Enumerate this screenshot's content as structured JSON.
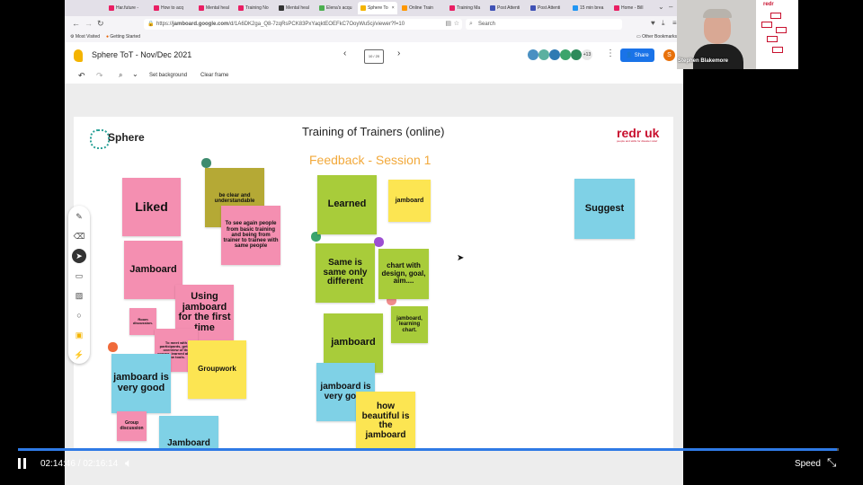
{
  "browser": {
    "tabs": [
      {
        "label": "Har.future -",
        "color": "#e91e63"
      },
      {
        "label": "How to acq",
        "color": "#e91e63"
      },
      {
        "label": "Mental heal",
        "color": "#e91e63"
      },
      {
        "label": "Training No",
        "color": "#e91e63"
      },
      {
        "label": "Mental heal",
        "color": "#333333"
      },
      {
        "label": "Elena's acqu",
        "color": "#4caf50"
      },
      {
        "label": "Sphere To",
        "color": "#f4b400"
      },
      {
        "label": "Online Train",
        "color": "#ff9800"
      },
      {
        "label": "Training Ma",
        "color": "#e91e63"
      },
      {
        "label": "Post Attenti",
        "color": "#3f51b5"
      },
      {
        "label": "Post Attenti",
        "color": "#3f51b5"
      },
      {
        "label": "15 min brea",
        "color": "#2196f3"
      },
      {
        "label": "Home - Bill",
        "color": "#e91e63"
      }
    ],
    "url_domain_prefix": "https://",
    "url_domain": "jamboard.google.com",
    "url_path": "/d/1A6DK2ga_Q8-7zqRsPCK83PxYaqktEOEFkC7OoyWu5cj/viewer?f=10",
    "search_placeholder": "Search",
    "bookmarks": [
      "Most Visited",
      "Getting Started"
    ],
    "other_bookmarks": "Other Bookmarks"
  },
  "app": {
    "title": "Sphere ToT - Nov/Dec 2021",
    "frame_counter": "10 / 20",
    "share_label": "Share",
    "extra_viewers": "+13",
    "avatar_initial": "S",
    "toolbar": {
      "set_background": "Set background",
      "clear_frame": "Clear frame"
    }
  },
  "frame": {
    "logo_text": "Sphere",
    "title": "Training of Trainers (online)",
    "subtitle": "Feedback - Session 1",
    "redr_brand": "redr uk",
    "redr_tagline": "people and skills for disaster relief",
    "notes": {
      "liked": "Liked",
      "be_clear": "be clear and understandable",
      "see_again": "To see again people from basic training and being from trainer to trainee with same people",
      "jamboard1": "Jamboard",
      "using_jamboard": "Using jamboard for the first time",
      "room_discussion": "Room discussion.",
      "meet_participants": "To meet with participants, get an overview of the course, learned about new tools.",
      "jamboard_very_good1": "jamboard is very good",
      "groupwork": "Groupwork",
      "group_discussion": "Group discussion",
      "jamboard_bottom": "Jamboard",
      "learned": "Learned",
      "jamboard_small": "jamboard",
      "same_is_same": "Same is same only different",
      "chart_with_design": "chart with design, goal, aim....",
      "jamboard_learning_chart": "jamboard, learning chart.",
      "jamboard_green": "jamboard",
      "jamboard_very_good2": "jamboard is very good",
      "how_beautiful": "how beautiful is the jamboard",
      "suggest": "Suggest"
    }
  },
  "webcam": {
    "name": "Stephen Blakemore",
    "slide_logo": "redr"
  },
  "player": {
    "current_time": "02:14:46",
    "separator": "/",
    "total_time": "02:16:14",
    "progress": 0.998,
    "speed_label": "Speed"
  },
  "colors": {
    "pink": "#f48fb1",
    "olive": "#b5a935",
    "yellow": "#fce552",
    "green": "#a8cc3a",
    "blue": "#7fd1e6",
    "subtitle_orange": "#f2a93b",
    "redr_red": "#c8102e",
    "progress_blue": "#2f7ae5",
    "share_blue": "#1a73e8"
  }
}
